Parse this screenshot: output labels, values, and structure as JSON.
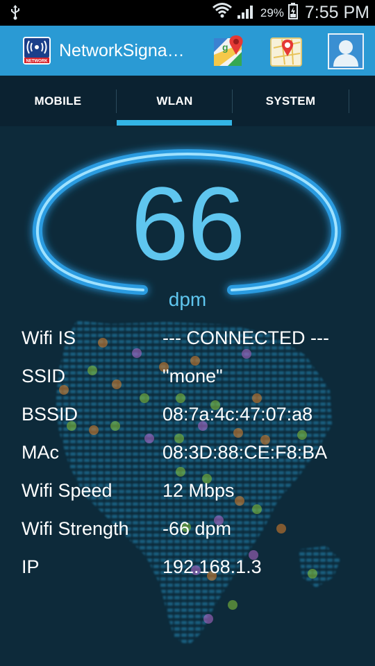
{
  "status_bar": {
    "battery_percent": "29%",
    "time": "7:55 PM",
    "icons": [
      "usb-icon",
      "wifi-icon",
      "cell-signal-icon",
      "battery-icon"
    ]
  },
  "app_bar": {
    "title": "NetworkSigna…",
    "app_icon_text": "NETWORK",
    "actions": [
      "maps-icon",
      "location-icon",
      "profile-icon"
    ]
  },
  "tabs": {
    "items": [
      {
        "label": "MOBILE"
      },
      {
        "label": "WLAN"
      },
      {
        "label": "SYSTEM"
      }
    ],
    "selected": "WLAN"
  },
  "gauge": {
    "value": "66",
    "unit": "dpm"
  },
  "wifi_info": [
    {
      "label": "Wifi IS",
      "value": "--- CONNECTED ---"
    },
    {
      "label": "SSID",
      "value": "\"mone\""
    },
    {
      "label": "BSSID",
      "value": "08:7a:4c:47:07:a8"
    },
    {
      "label": "MAc",
      "value": "08:3D:88:CE:F8:BA"
    },
    {
      "label": "Wifi Speed",
      "value": "12 Mbps"
    },
    {
      "label": "Wifi Strength",
      "value": "-66 dpm"
    },
    {
      "label": "IP",
      "value": "192.168.1.3"
    }
  ],
  "colors": {
    "status_bar": "#000000",
    "action_bar": "#2a9ad4",
    "tab_bar": "#0b2231",
    "tab_indicator": "#33b5e5",
    "content_bg": "#0d2a3a",
    "accent_text": "#5fc6ef"
  }
}
